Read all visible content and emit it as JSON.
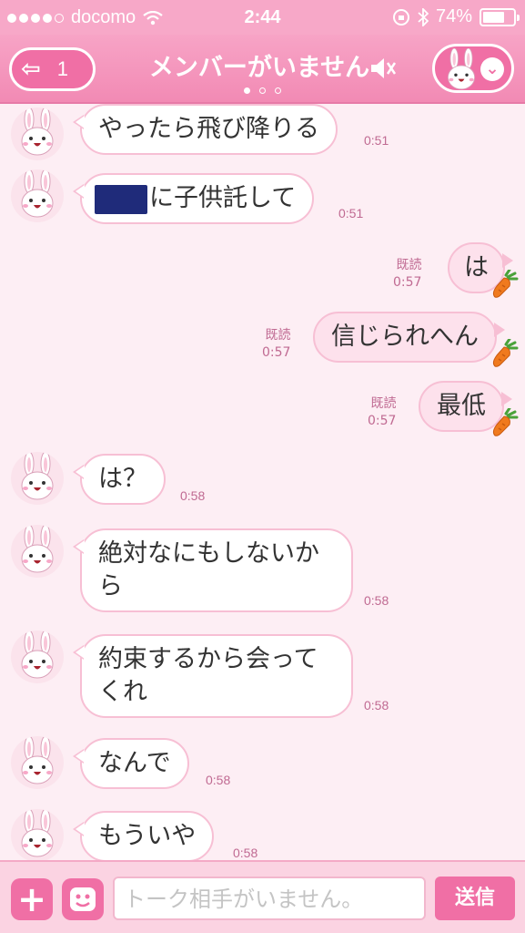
{
  "status_bar": {
    "carrier": "docomo",
    "time": "2:44",
    "battery": "74%",
    "battery_level": 0.74
  },
  "header": {
    "back_count": "1",
    "title": "メンバーがいません",
    "page_indicator": {
      "count": 3,
      "active": 0
    },
    "accent_color": "#f06fa5"
  },
  "messages": [
    {
      "side": "in",
      "text": "やったら飛び降りる",
      "time": "0:51"
    },
    {
      "side": "in",
      "text": "に子供託して",
      "time": "0:51",
      "redacted_prefix": true
    },
    {
      "side": "out",
      "text": "は",
      "read": "既読",
      "time": "0:57"
    },
    {
      "side": "out",
      "text": "信じられへん",
      "read": "既読",
      "time": "0:57"
    },
    {
      "side": "out",
      "text": "最低",
      "read": "既読",
      "time": "0:57"
    },
    {
      "side": "in",
      "text": "は？",
      "time": "0:58"
    },
    {
      "side": "in",
      "line1": "絶対なにもしないか",
      "line2": "ら",
      "time": "0:58"
    },
    {
      "side": "in",
      "line1": "約束するから会って",
      "line2": "くれ",
      "time": "0:58"
    },
    {
      "side": "in",
      "text": "なんで",
      "time": "0:58"
    },
    {
      "side": "in",
      "text": "もういや",
      "time": "0:58"
    }
  ],
  "input_bar": {
    "placeholder": "トーク相手がいません。",
    "send_label": "送信"
  },
  "icons": {
    "back": "back-arrow-icon",
    "mute": "speaker-muted-icon",
    "profile": "bunny-face-icon",
    "read_decoration": "carrot-icon",
    "plus": "plus-icon",
    "sticker": "sticker-face-icon"
  }
}
